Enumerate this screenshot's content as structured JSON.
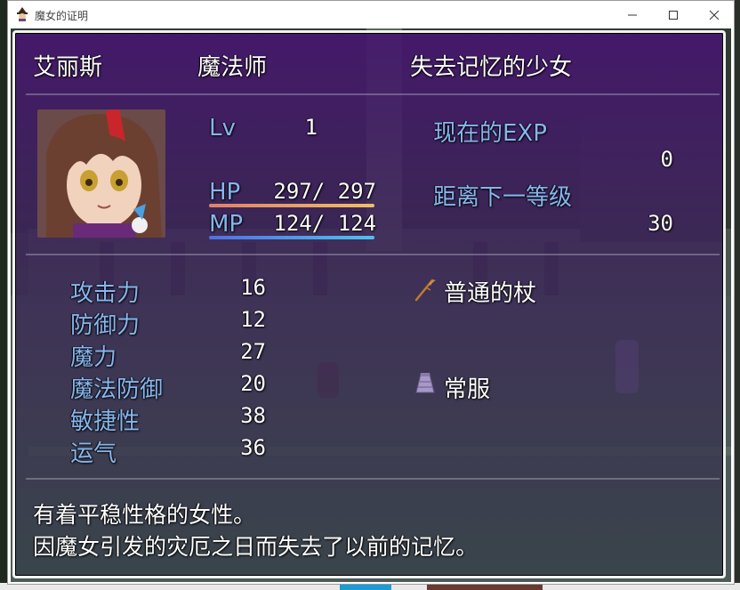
{
  "window": {
    "title": "魔女的证明"
  },
  "status": {
    "name": "艾丽斯",
    "class": "魔法师",
    "nickname": "失去记忆的少女",
    "level_label": "Lv",
    "level": "1",
    "hp_label": "HP",
    "hp_value": "297/ 297",
    "hp_fraction": 1.0,
    "mp_label": "MP",
    "mp_value": "124/ 124",
    "mp_fraction": 1.0,
    "exp_label": "现在的EXP",
    "exp_value": "0",
    "next_label": "距离下一等级",
    "next_value": "30"
  },
  "params": [
    {
      "label": "攻击力",
      "value": "16"
    },
    {
      "label": "防御力",
      "value": "12"
    },
    {
      "label": "魔力",
      "value": "27"
    },
    {
      "label": "魔法防御",
      "value": "20"
    },
    {
      "label": "敏捷性",
      "value": "38"
    },
    {
      "label": "运气",
      "value": "36"
    }
  ],
  "equipment": [
    {
      "name": "普通的杖",
      "icon": "staff-icon"
    },
    {
      "name": "",
      "icon": ""
    },
    {
      "name": "",
      "icon": ""
    },
    {
      "name": "常服",
      "icon": "clothes-icon"
    }
  ],
  "profile": {
    "line1": "有着平稳性格的女性。",
    "line2": "因魔女引发的灾厄之日而失去了以前的记忆。"
  },
  "colors": {
    "system_text": "#86b6ee",
    "hp_gauge_start": "#e0806c",
    "hp_gauge_end": "#f0c060",
    "mp_gauge_start": "#5070e0",
    "mp_gauge_end": "#50c0f0",
    "window_tone": "#46166e"
  }
}
